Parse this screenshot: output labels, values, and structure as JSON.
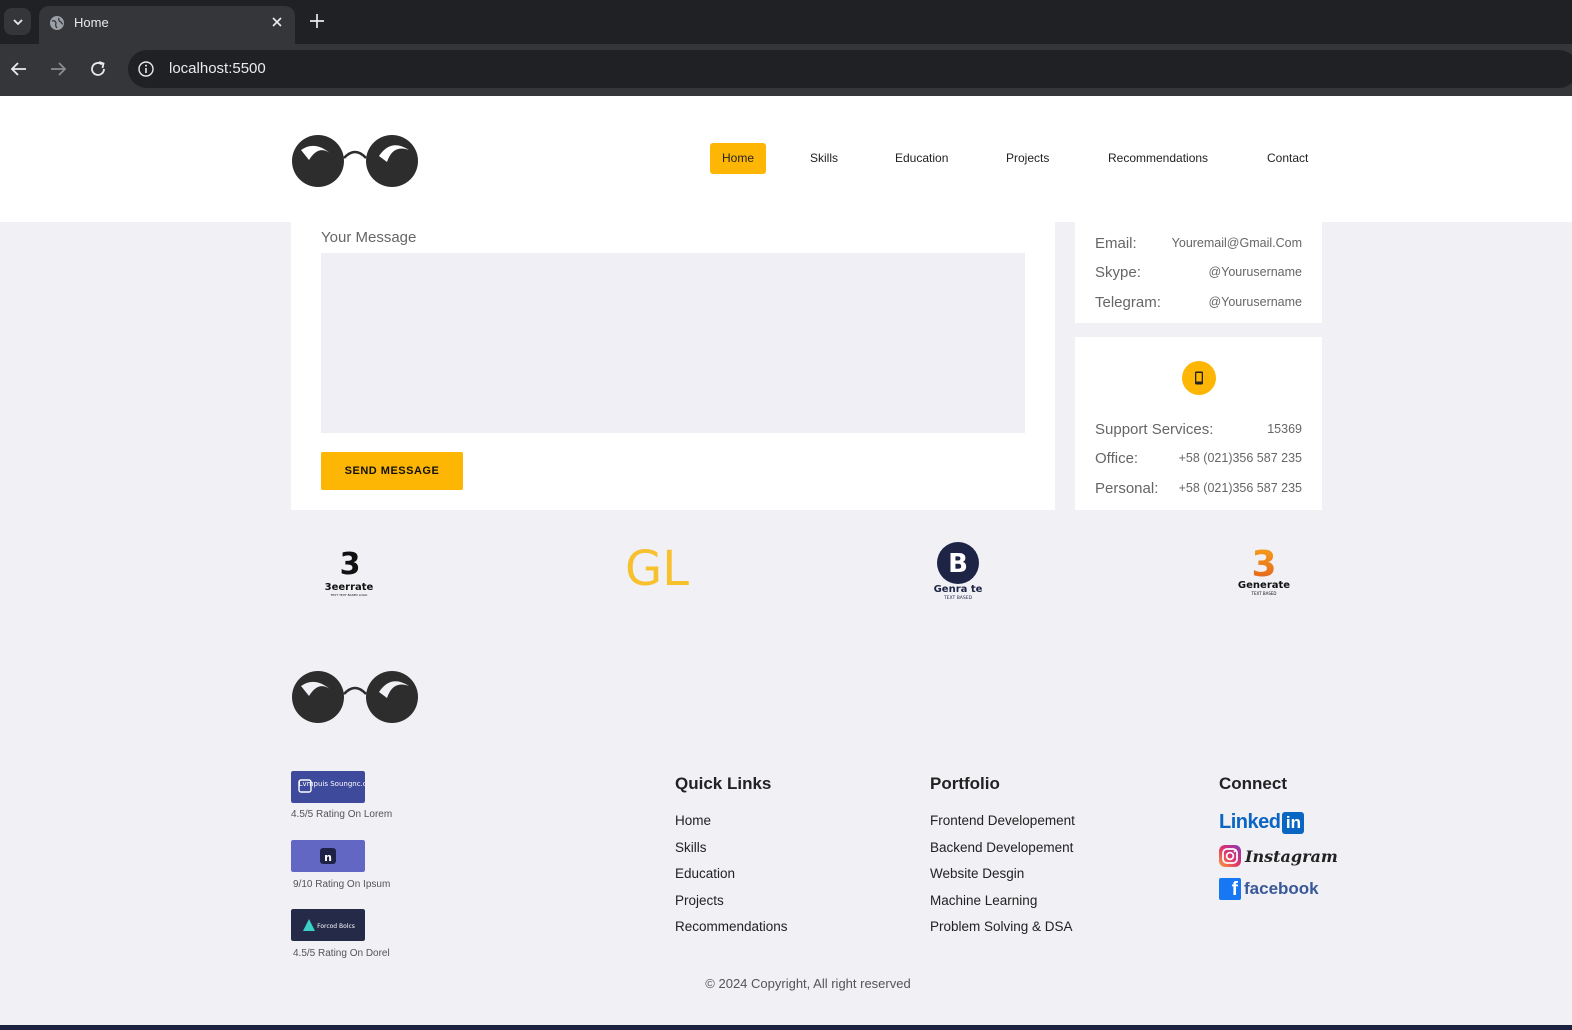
{
  "browser": {
    "tab_title": "Home",
    "url": "localhost:5500"
  },
  "nav": {
    "items": [
      "Home",
      "Skills",
      "Education",
      "Projects",
      "Recommendations",
      "Contact"
    ],
    "active": "Home"
  },
  "contact_form": {
    "message_label": "Your Message",
    "message_value": "",
    "send_label": "SEND MESSAGE"
  },
  "contact_info": {
    "online": [
      {
        "label": "Email:",
        "value": "Youremail@Gmail.Com"
      },
      {
        "label": "Skype:",
        "value": "@Yourusername"
      },
      {
        "label": "Telegram:",
        "value": "@Yourusername"
      }
    ],
    "phone_icon": "mobile-phone-icon",
    "phones": [
      {
        "label": "Support Services:",
        "value": "15369"
      },
      {
        "label": "Office:",
        "value": "+58 (021)356 587 235"
      },
      {
        "label": "Personal:",
        "value": "+58 (021)356 587 235"
      }
    ]
  },
  "brands": [
    {
      "name": "3eerrate",
      "sub": "TEXT TEXT BASED LOGO"
    },
    {
      "name": "GL",
      "sub": ""
    },
    {
      "name": "Genra te",
      "sub": "TEXT BASED"
    },
    {
      "name": "Generate",
      "sub": "TEXT BASED"
    }
  ],
  "ratings": [
    {
      "badge": "Lvmpuis Soungnc.cou",
      "text": "4.5/5 Rating On Lorem",
      "color": "#3e4a9c"
    },
    {
      "badge": "n",
      "text": "9/10 Rating On Ipsum",
      "color": "#6167c2"
    },
    {
      "badge": "Forcod Bolcs",
      "text": "4.5/5 Rating On Dorel",
      "color": "#252a49"
    }
  ],
  "footer": {
    "quick_links_title": "Quick Links",
    "quick_links": [
      "Home",
      "Skills",
      "Education",
      "Projects",
      "Recommendations"
    ],
    "portfolio_title": "Portfolio",
    "portfolio": [
      "Frontend Developement",
      "Backend Developement",
      "Website Desgin",
      "Machine Learning",
      "Problem Solving & DSA"
    ],
    "connect_title": "Connect",
    "social": {
      "linkedin": "Linked",
      "linkedin_in": "in",
      "instagram": "Instagram",
      "facebook": "facebook"
    },
    "copyright": "© 2024 Copyright, All right reserved"
  },
  "colors": {
    "accent": "#fdb604",
    "page_bg": "#f0f0f5",
    "linkedin": "#0a66c2",
    "facebook": "#1877f2"
  }
}
